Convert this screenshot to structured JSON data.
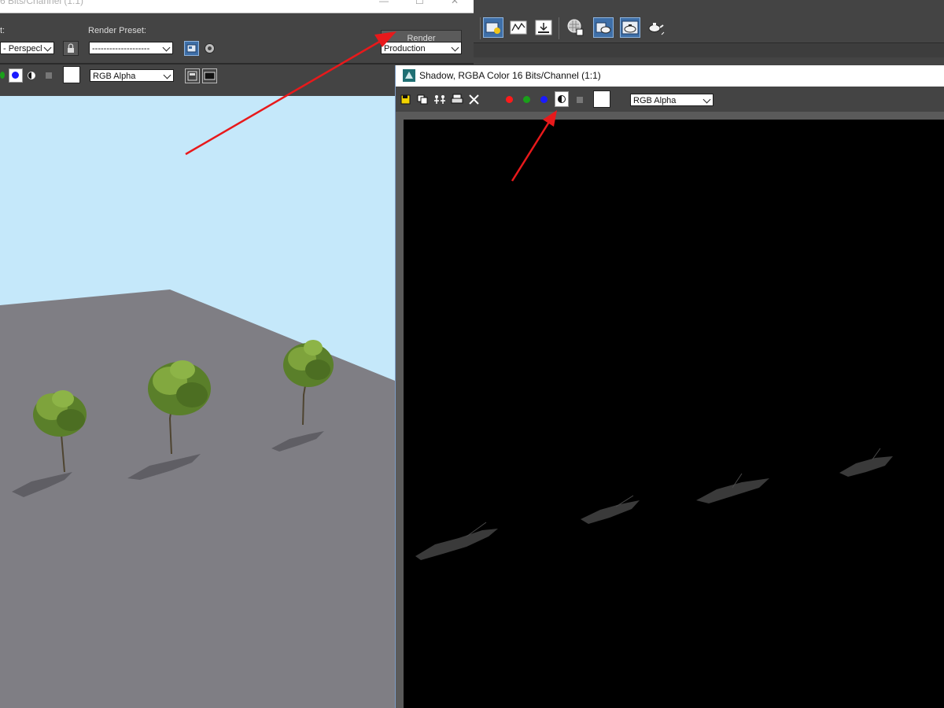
{
  "left_window": {
    "title": "6 Bits/Channel (1:1)",
    "area_label": "t:",
    "view_value": "- Perspecl",
    "render_preset_label": "Render Preset:",
    "render_preset_value": "--------------------",
    "render_button": "Render",
    "production_value": "Production",
    "channel_display": "RGB Alpha",
    "minimize_glyph": "—",
    "maximize_glyph": "☐",
    "close_glyph": "✕"
  },
  "shadow_window": {
    "title": "Shadow, RGBA Color 16 Bits/Channel (1:1)",
    "channel_display": "RGB Alpha"
  },
  "colors": {
    "accent_blue": "#3e6fa8",
    "annotation_arrow": "#e8191b",
    "sky": "#c5e8fa",
    "ground": "#7f7e84",
    "channel_red": "#ff1a1a",
    "channel_green": "#1aa01a",
    "channel_blue": "#1a1aff"
  },
  "icons": {
    "lock": "lock-icon",
    "save": "save-icon",
    "copy": "copy-icon",
    "clone": "clone-icon",
    "print": "print-icon",
    "clear": "close-icon",
    "mono": "monochrome-icon",
    "alpha": "alpha-channel-icon"
  }
}
